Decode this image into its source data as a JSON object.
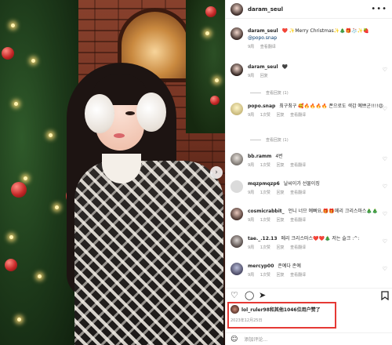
{
  "post": {
    "username": "daram_seul",
    "more_icon": "ellipsis-icon"
  },
  "photo": {
    "next_icon": "chevron-right-icon",
    "next_glyph": "›"
  },
  "comments": [
    {
      "user": "daram_seul",
      "text": "❤️ ✨Merry Christmas✨🎄🎁🧦✨🍓",
      "tag": "@popo.snap",
      "meta": [
        "9周",
        "查看翻译"
      ]
    },
    {
      "user": "daram_seul",
      "text": "🖤",
      "meta": [
        "9周",
        "回复"
      ]
    },
    {
      "user": "popo.snap",
      "text": "최구최구 🥰🔥🔥🔥🔥 폰으로도 색감 예쁘군!!!!😍",
      "meta": [
        "9周",
        "1次赞",
        "回复",
        "查看翻译"
      ]
    },
    {
      "user": "bb.ramm",
      "text": "4번",
      "meta": [
        "9周",
        "1次赞",
        "回复",
        "查看翻译"
      ]
    },
    {
      "user": "mqzpmqzp6",
      "text": "날씨이가 선물이징",
      "meta": [
        "9周",
        "1次赞",
        "回复",
        "查看翻译"
      ]
    },
    {
      "user": "cosmicrabbit_",
      "text": "언니 너므 예뻐요,🎁🎁메리 크리스마스🎄🎄",
      "meta": [
        "9周",
        "1次赞",
        "回复",
        "查看翻译"
      ]
    },
    {
      "user": "tae._.12.13",
      "text": "메리 크리스마스❤️❤️🎄 저는 슬크 :^:",
      "meta": [
        "9周",
        "1次赞",
        "回复",
        "查看翻译"
      ]
    },
    {
      "user": "mercyp00",
      "text": "존예다 존예",
      "meta": [
        "9周",
        "1次赞",
        "回复",
        "查看翻译"
      ]
    }
  ],
  "view_replies": [
    "查看回复 (1)",
    "查看回复 (1)"
  ],
  "actions": {
    "like_glyph": "♡",
    "comment_glyph": "◯",
    "share_glyph": "➤",
    "save_glyph": "⧉"
  },
  "likes": {
    "text": "lol_ruler98和其他1046位用户赞了"
  },
  "date": "2023年12月25日",
  "add_comment": {
    "placeholder": "添加评论...",
    "emoji_glyph": "☺"
  }
}
